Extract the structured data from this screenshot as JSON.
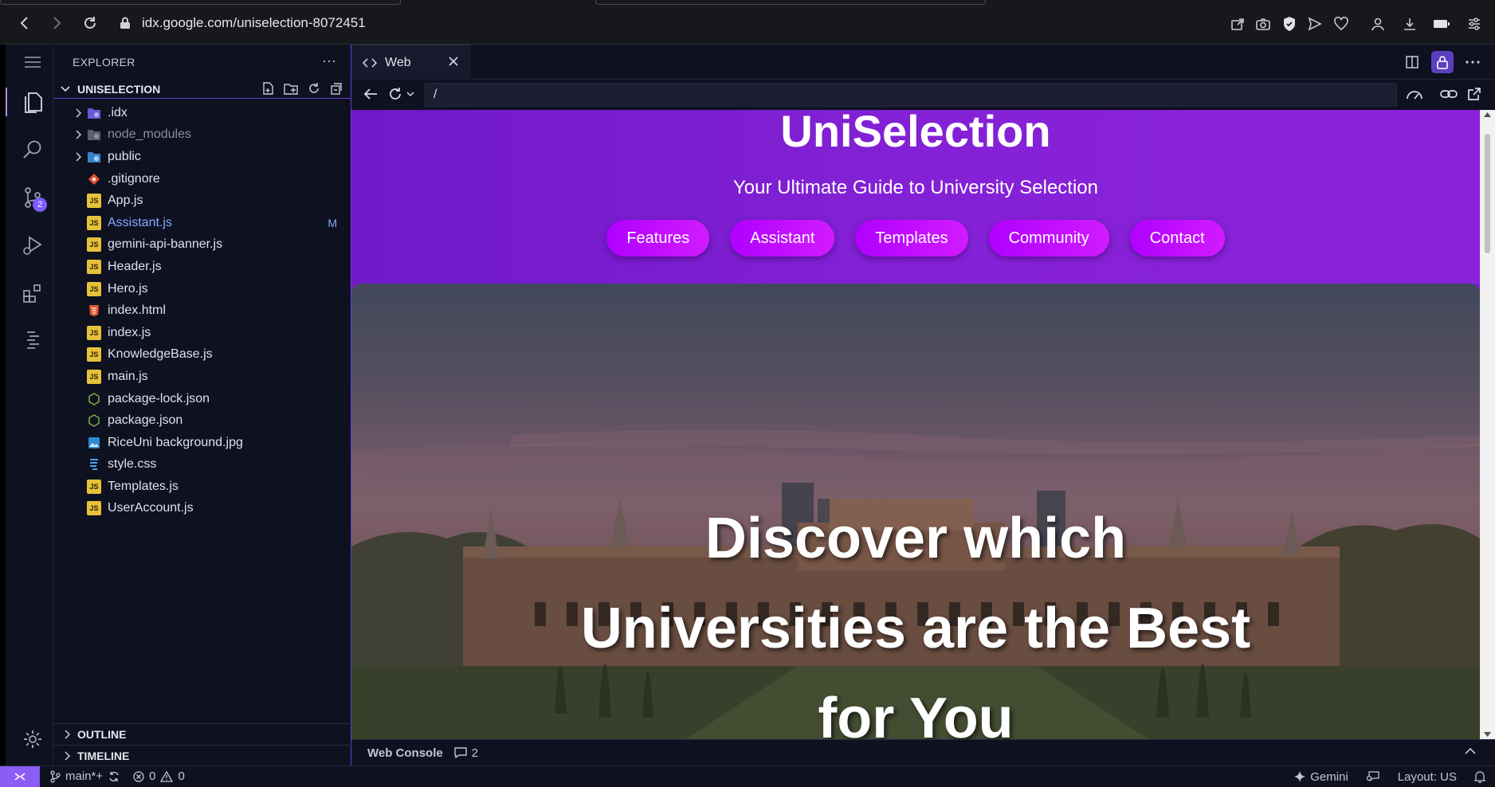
{
  "browser": {
    "url": "idx.google.com/uniselection-8072451"
  },
  "sidebar": {
    "title": "EXPLORER",
    "more": "···",
    "root_folder": "UNISELECTION",
    "files": [
      {
        "name": ".idx",
        "type": "folder",
        "icon": "idx-folder-icon"
      },
      {
        "name": "node_modules",
        "type": "folder",
        "icon": "node-modules-folder-icon"
      },
      {
        "name": "public",
        "type": "folder",
        "icon": "public-folder-icon"
      },
      {
        "name": ".gitignore",
        "type": "file",
        "icon": "git-icon"
      },
      {
        "name": "App.js",
        "type": "file",
        "icon": "js-file-icon"
      },
      {
        "name": "Assistant.js",
        "type": "file",
        "icon": "js-file-icon",
        "status": "M"
      },
      {
        "name": "gemini-api-banner.js",
        "type": "file",
        "icon": "js-file-icon"
      },
      {
        "name": "Header.js",
        "type": "file",
        "icon": "js-file-icon"
      },
      {
        "name": "Hero.js",
        "type": "file",
        "icon": "js-file-icon"
      },
      {
        "name": "index.html",
        "type": "file",
        "icon": "html-file-icon"
      },
      {
        "name": "index.js",
        "type": "file",
        "icon": "js-file-icon"
      },
      {
        "name": "KnowledgeBase.js",
        "type": "file",
        "icon": "js-file-icon"
      },
      {
        "name": "main.js",
        "type": "file",
        "icon": "js-file-icon"
      },
      {
        "name": "package-lock.json",
        "type": "file",
        "icon": "json-file-icon"
      },
      {
        "name": "package.json",
        "type": "file",
        "icon": "json-file-icon"
      },
      {
        "name": "RiceUni background.jpg",
        "type": "file",
        "icon": "image-file-icon"
      },
      {
        "name": "style.css",
        "type": "file",
        "icon": "css-file-icon"
      },
      {
        "name": "Templates.js",
        "type": "file",
        "icon": "js-file-icon"
      },
      {
        "name": "UserAccount.js",
        "type": "file",
        "icon": "js-file-icon"
      }
    ],
    "outline": "OUTLINE",
    "timeline": "TIMELINE"
  },
  "activity": {
    "scm_badge": "2"
  },
  "editor": {
    "tab_label": "Web",
    "address": "/"
  },
  "site": {
    "title": "UniSelection",
    "subtitle": "Your Ultimate Guide to University Selection",
    "nav": [
      "Features",
      "Assistant",
      "Templates",
      "Community",
      "Contact"
    ],
    "hero_lines": [
      "Discover which",
      "Universities are the Best",
      "for You"
    ]
  },
  "panel": {
    "label": "Web Console",
    "count": "2"
  },
  "status": {
    "branch": "main*+",
    "errors": "0",
    "warnings": "0",
    "gemini": "Gemini",
    "layout": "Layout: US"
  },
  "colors": {
    "accent": "#8b5cf6",
    "header_purple": "#8421d6",
    "pill_magenta": "#c40cff"
  }
}
